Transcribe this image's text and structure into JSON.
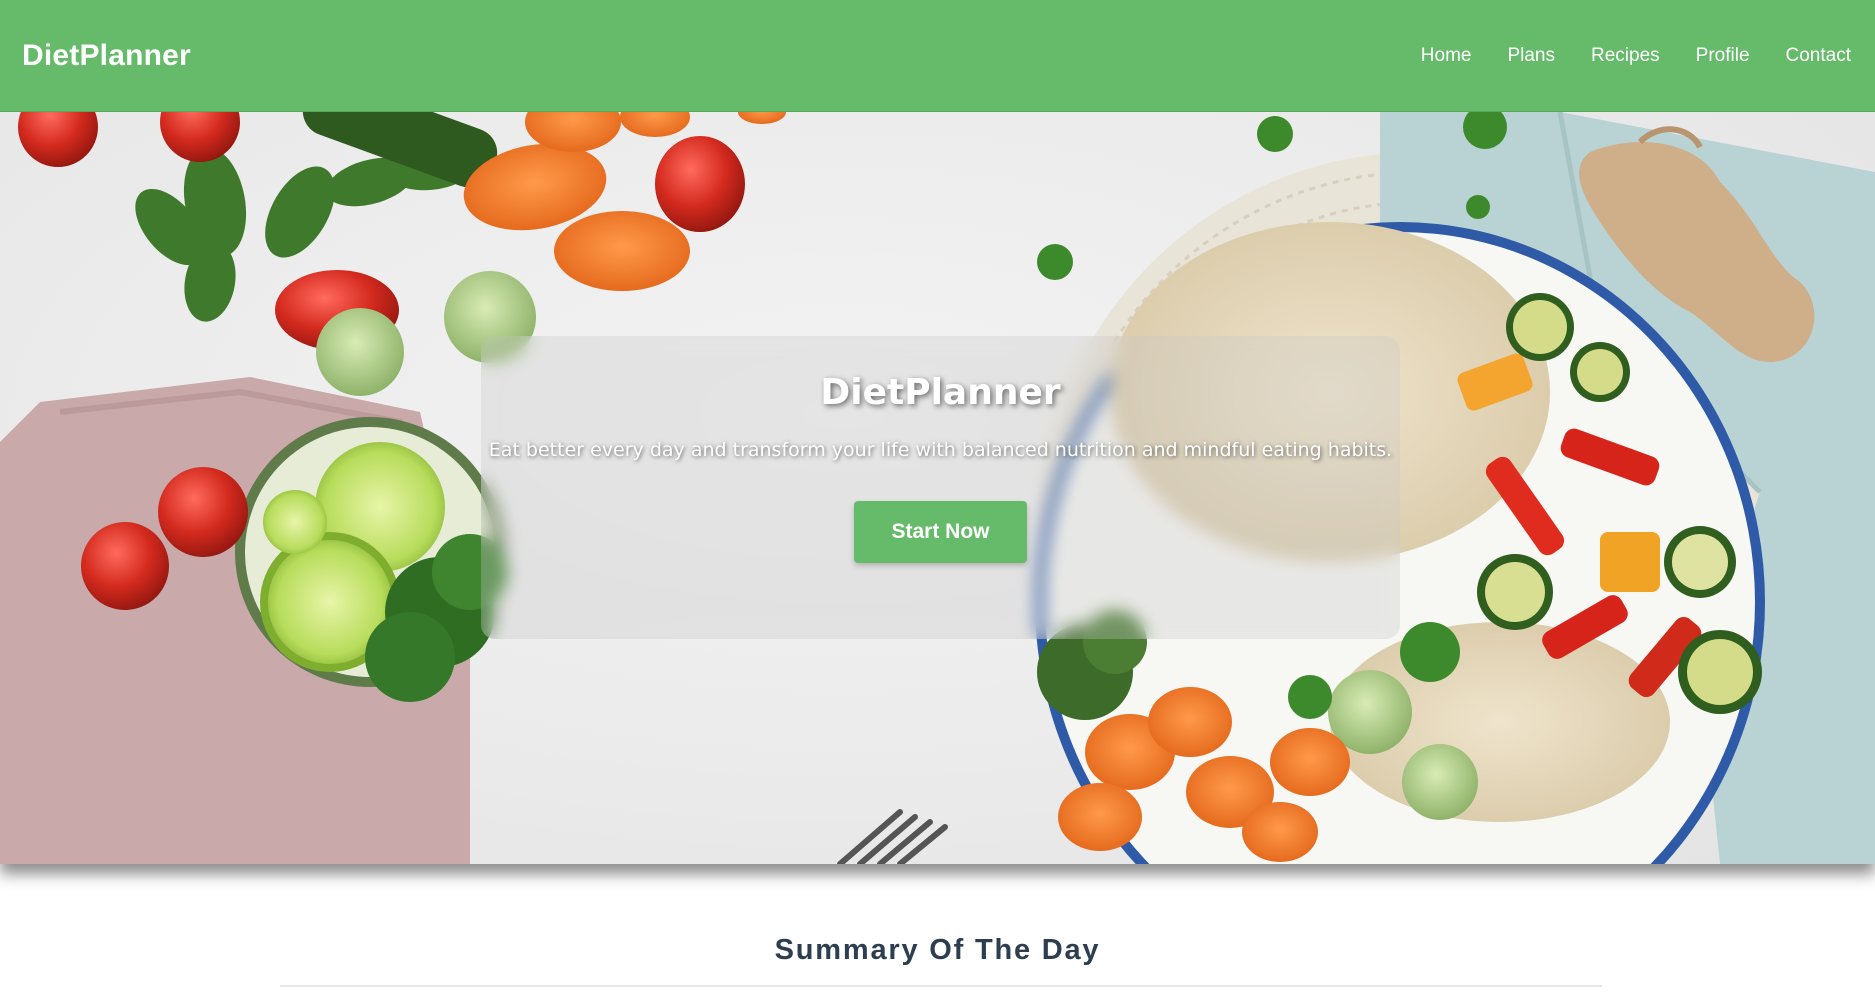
{
  "nav": {
    "brand": "DietPlanner",
    "links": [
      "Home",
      "Plans",
      "Recipes",
      "Profile",
      "Contact"
    ]
  },
  "hero": {
    "title": "DietPlanner",
    "subtitle": "Eat better every day and transform your life with balanced nutrition and mindful eating habits.",
    "cta_label": "Start Now"
  },
  "summary": {
    "title": "Summary Of The Day"
  },
  "colors": {
    "brand_green": "#66bb6a",
    "heading_dark": "#2c3e50"
  }
}
